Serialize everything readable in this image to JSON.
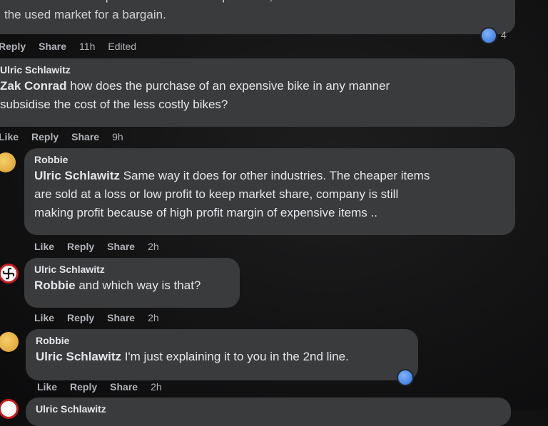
{
  "comments": [
    {
      "text_top": "...ut a nice bike helps subsidize the cheaper ones, and those nicer bikes will turn",
      "text": "the used market for a bargain.",
      "actions": {
        "reply": "Reply",
        "share": "Share",
        "time": "11h",
        "edited": "Edited"
      },
      "reaction_count": "4"
    },
    {
      "name": "Ulric Schlawitz",
      "tag": "Zak Conrad",
      "text_line1": " how does the purchase of an expensive bike in any manner",
      "text_line2": "subsidise the cost of the less costly bikes?",
      "actions": {
        "like": "Like",
        "reply": "Reply",
        "share": "Share",
        "time": "9h"
      }
    },
    {
      "name": "Robbie",
      "tag": "Ulric Schlawitz",
      "text_line1": " Same way it does for other industries. The cheaper items",
      "text_line2": "are sold at a loss or low profit to keep market share, company is still",
      "text_line3": "making profit because of high profit margin of expensive items ..",
      "actions": {
        "like": "Like",
        "reply": "Reply",
        "share": "Share",
        "time": "2h"
      }
    },
    {
      "name": "Ulric Schlawitz",
      "tag": "Robbie",
      "text": " and which way is that?",
      "actions": {
        "like": "Like",
        "reply": "Reply",
        "share": "Share",
        "time": "2h"
      }
    },
    {
      "name": "Robbie",
      "tag": "Ulric Schlawitz",
      "text": " I'm just explaining it to you in the 2nd line.",
      "actions": {
        "like": "Like",
        "reply": "Reply",
        "share": "Share",
        "time": "2h"
      }
    },
    {
      "name": "Ulric Schlawitz"
    }
  ],
  "icons": {
    "reaction": "like-reaction-icon",
    "avatar_robbie": "emoji-avatar",
    "avatar_ulric": "flag-avatar"
  }
}
